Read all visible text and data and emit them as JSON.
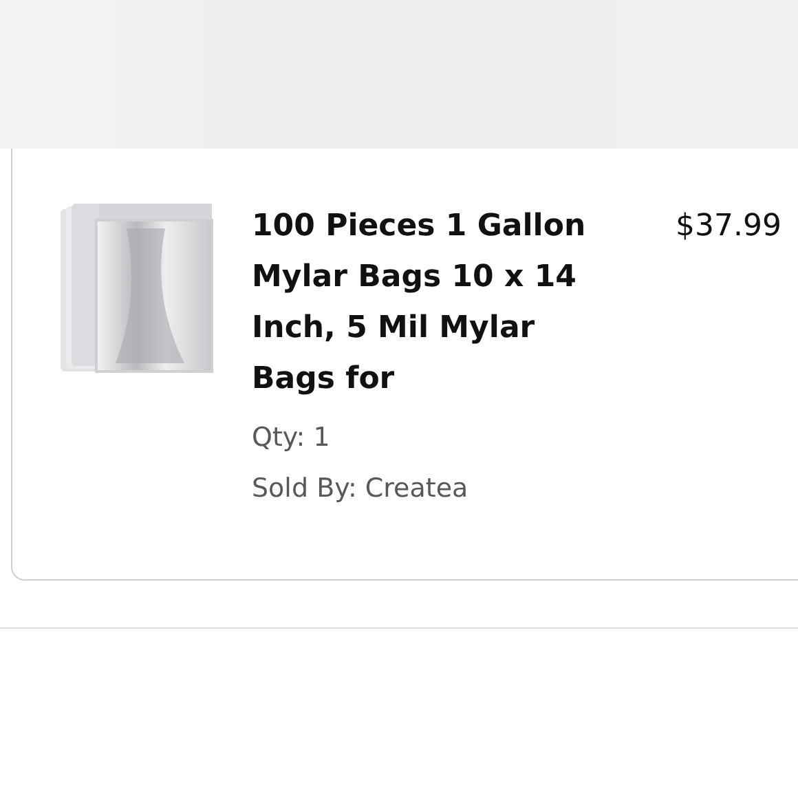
{
  "order_item": {
    "title": "100 Pieces 1 Gallon Mylar Bags 10 x 14 Inch, 5 Mil Mylar Bags for",
    "price": "$37.99",
    "quantity": "Qty: 1",
    "seller": "Sold By: Createa"
  }
}
